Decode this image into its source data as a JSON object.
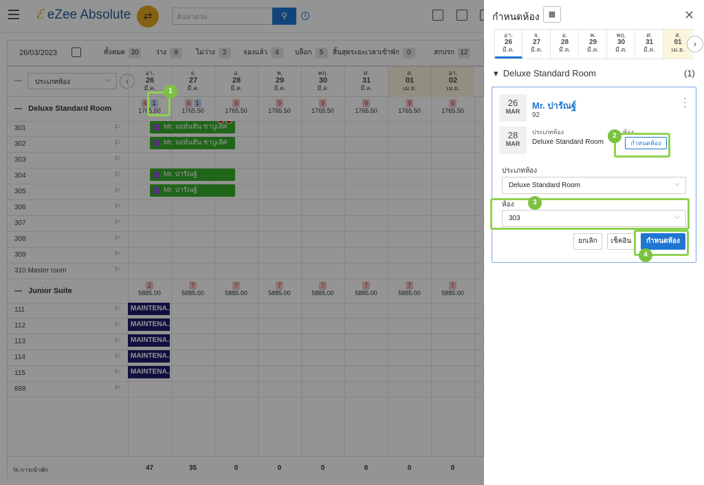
{
  "app": {
    "logo_text": "eZee Absolute",
    "search_placeholder": "ค้นหาด่วน"
  },
  "statbar": {
    "date": "26/03/2023",
    "stats": [
      {
        "label": "ทั้งหมด",
        "count": "20"
      },
      {
        "label": "ว่าง",
        "count": "9"
      },
      {
        "label": "ไม่ว่าง",
        "count": "2"
      },
      {
        "label": "จองแล้ว",
        "count": "4"
      },
      {
        "label": "บล็อก",
        "count": "5"
      },
      {
        "label": "สิ้นสุดระยะเวลาเข้าพัก",
        "count": "0"
      },
      {
        "label": "สกปรก",
        "count": "12"
      }
    ]
  },
  "grid": {
    "room_type_select": "ประเภทห้อง",
    "dates": [
      {
        "dow": "อา.",
        "day": "26",
        "month": "มี.ค."
      },
      {
        "dow": "จ.",
        "day": "27",
        "month": "มี.ค."
      },
      {
        "dow": "อ.",
        "day": "28",
        "month": "มี.ค."
      },
      {
        "dow": "พ.",
        "day": "29",
        "month": "มี.ค."
      },
      {
        "dow": "พฤ.",
        "day": "30",
        "month": "มี.ค."
      },
      {
        "dow": "ศ.",
        "day": "31",
        "month": "มี.ค."
      },
      {
        "dow": "ส.",
        "day": "01",
        "month": "เม.ย."
      },
      {
        "dow": "อา.",
        "day": "02",
        "month": "เม.ย."
      }
    ],
    "deluxe": {
      "name": "Deluxe Standard Room",
      "avail": [
        [
          "4",
          "1"
        ],
        [
          "4",
          "1"
        ],
        [
          "9"
        ],
        [
          "9"
        ],
        [
          "9"
        ],
        [
          "9"
        ],
        [
          "9"
        ],
        [
          "9"
        ]
      ],
      "price": "1765.50",
      "rooms": [
        "301",
        "302",
        "303",
        "304",
        "305",
        "306",
        "307",
        "308",
        "309",
        "310 Master room"
      ]
    },
    "junior": {
      "name": "Junior Suite",
      "avail": [
        "2",
        "7",
        "7",
        "7",
        "7",
        "7",
        "7",
        "7"
      ],
      "price": "5885.00",
      "rooms": [
        "111",
        "112",
        "113",
        "114",
        "115",
        "888"
      ]
    },
    "bookings": [
      "Mr. จอห์นสัน ชาบูเลิศ",
      "Mr. จอห์นสัน ชาบูเลิศ",
      "Mr. ปารัณฐ์",
      "Mr. ปารัณฐ์"
    ],
    "maintenance_label": "MAINTENA...",
    "footer": {
      "label": "% การเข้าพัก",
      "values": [
        "47",
        "35",
        "0",
        "0",
        "0",
        "0",
        "0",
        "0"
      ]
    }
  },
  "panel": {
    "title": "กำหนดห้อง",
    "dates": [
      {
        "dow": "อา.",
        "day": "26",
        "month": "มี.ค."
      },
      {
        "dow": "จ.",
        "day": "27",
        "month": "มี.ค."
      },
      {
        "dow": "อ.",
        "day": "28",
        "month": "มี.ค."
      },
      {
        "dow": "พ.",
        "day": "29",
        "month": "มี.ค."
      },
      {
        "dow": "พฤ.",
        "day": "30",
        "month": "มี.ค."
      },
      {
        "dow": "ศ.",
        "day": "31",
        "month": "มี.ค."
      },
      {
        "dow": "ส.",
        "day": "01",
        "month": "เม.ย."
      }
    ],
    "section_title": "Deluxe Standard Room",
    "section_count": "(1)",
    "card": {
      "arrive_day": "26",
      "arrive_mon": "MAR",
      "depart_day": "28",
      "depart_mon": "MAR",
      "guest": "Mr. ปารัณฐ์",
      "number": "92",
      "rt_label": "ประเภทห้อง",
      "rt_value": "Deluxe Standard Room",
      "room_label": "ห้อง",
      "assign_small": "กำหนดห้อง",
      "field_rt_label": "ประเภทห้อง",
      "field_rt_value": "Deluxe Standard Room",
      "field_room_label": "ห้อง",
      "field_room_value": "303",
      "btn_cancel": "ยกเลิก",
      "btn_checkin": "เช็คอิน",
      "btn_assign": "กำหนดห้อง"
    },
    "steps": [
      "1",
      "2",
      "3",
      "4"
    ]
  }
}
